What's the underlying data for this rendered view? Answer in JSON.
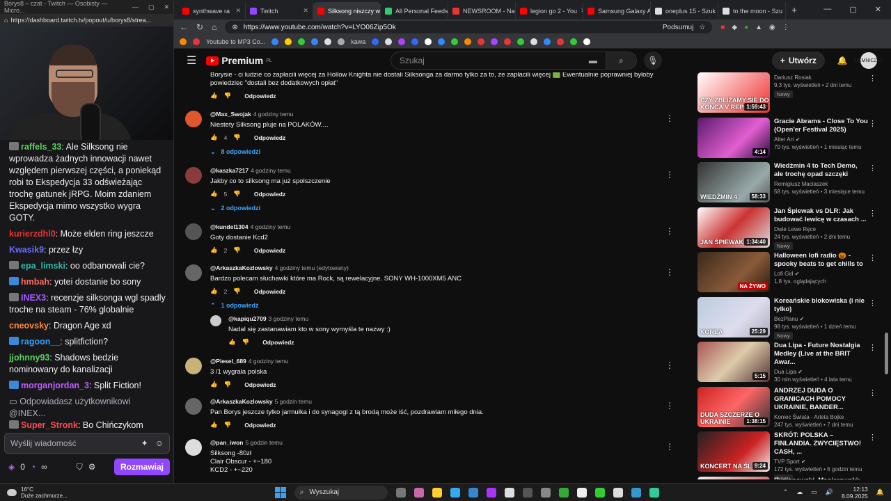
{
  "twitch": {
    "title": "Borys8 – czat - Twitch — Osobisty — Micro...",
    "url": "https://dashboard.twitch.tv/popout/u/borys8/strea...",
    "messages": [
      {
        "user": "raffels_33",
        "color": "#5fd05f",
        "badge": "g",
        "text": "Ale Silksong nie wprowadza żadnych innowacji nawet względem pierwszej części, a poniekąd robi to Ekspedycja 33 odświeżając trochę gatunek jRPG. Moim zdaniem Ekspedycja mimo wszystko wygra GOTY."
      },
      {
        "user": "kurierzdhl0",
        "color": "#e5332f",
        "badge": "",
        "text": "Może elden ring jeszcze"
      },
      {
        "user": "Kwasik9",
        "color": "#6b6bff",
        "badge": "",
        "text": "przez łzy"
      },
      {
        "user": "epa_limski",
        "color": "#2fb5a5",
        "badge": "g",
        "text": "oo odbanowali cie?"
      },
      {
        "user": "hmbah",
        "color": "#ff6a5b",
        "badge": "b",
        "text": "yotei dostanie bo sony"
      },
      {
        "user": "INEX3",
        "color": "#a45bff",
        "badge": "g",
        "text": "recenzje silksonga wgl spadly troche na steam - 76% globalnie"
      },
      {
        "user": "cneovsky",
        "color": "#ff8a3a",
        "badge": "",
        "text": "Dragon Age xd"
      },
      {
        "user": "ragoon__",
        "color": "#2fa0ff",
        "badge": "b",
        "text": "splitfiction?"
      },
      {
        "user": "jjohnny93",
        "color": "#5fd05f",
        "badge": "",
        "text": "Shadows bedzie nominowany do kanalizacji"
      },
      {
        "user": "morganjordan_3",
        "color": "#c45bff",
        "badge": "b",
        "text": "Split Fiction!"
      }
    ],
    "reply_note": "Odpowiadasz użytkownikowi @INEX...",
    "last_msg": {
      "user": "Super_Stronk",
      "color": "#ff4a4a",
      "text": "Bo Chińczykom tłumaczenie się nie podoba"
    },
    "input_placeholder": "Wyślij wiadomość",
    "points": "0",
    "infinity": "∞",
    "chat_button": "Rozmawiaj"
  },
  "browser": {
    "tabs": [
      {
        "label": "synthwave ra",
        "color": "#f00"
      },
      {
        "label": "Twitch",
        "color": "#9147ff"
      },
      {
        "label": "Silksong niszczy w",
        "color": "#f00",
        "active": true
      },
      {
        "label": "All Personal Feeds",
        "color": "#2ecc71"
      },
      {
        "label": "NEWSROOM - Na",
        "color": "#e33"
      },
      {
        "label": "legion go 2 - You",
        "color": "#f00"
      },
      {
        "label": "Samsung Galaxy A",
        "color": "#f00"
      },
      {
        "label": "oneplus 15 - Szuk",
        "color": "#ddd"
      },
      {
        "label": "to the moon - Szu",
        "color": "#ddd"
      }
    ],
    "url": "https://www.youtube.com/watch?v=LYO06Zip5Ok",
    "summarize": "Podsumuj",
    "bookmarks": [
      "Youtube to MP3 Co...",
      "kawa"
    ]
  },
  "youtube": {
    "logo": "Premium",
    "logo_sup": "PL",
    "search_placeholder": "Szukaj",
    "create": "Utwórz",
    "avatar_text": "ZIEMNICZAK",
    "reply_label": "Odpowiedz",
    "top_comment": {
      "text": "Borysie - ci ludzie co zapłacili więcej za Hollow Knighta nie dostali Silksonga za darmo tylko za to, że zapłacili więcej 🟩 Ewentualnie poprawniej byłoby powiedziec \"dostali bez  dodatkowych opłat\""
    },
    "comments": [
      {
        "user": "@Max_Swojak",
        "time": "4 godziny temu",
        "text": "Niestety Silksong pluje na POLAKÓW....",
        "likes": "4",
        "replies": "8 odpowiedzi",
        "av": "#e0562d"
      },
      {
        "user": "@kaszka7217",
        "time": "4 godziny temu",
        "text": "Jakby co to silksong ma już spolszczenie",
        "likes": "5",
        "replies": "2 odpowiedzi",
        "av": "#8a3b3b"
      },
      {
        "user": "@kundel1304",
        "time": "4 godziny temu",
        "text": "Goty dostanie Kcd2",
        "likes": "2",
        "replies": "",
        "av": "#555"
      },
      {
        "user": "@ArkaszkaKozlowsky",
        "time": "4 godziny temu (edytowany)",
        "text": "Bardzo polecam słuchawki które ma Rock, są rewelacyjne. SONY WH-1000XM5 ANC",
        "likes": "2",
        "replies": "1 odpowiedź",
        "av": "#666"
      },
      {
        "user": "@Piesel_689",
        "time": "4 godziny temu",
        "text": "3 /1  wygrała polska",
        "likes": "",
        "replies": "",
        "av": "#c9b27a"
      },
      {
        "user": "@ArkaszkaKozlowsky",
        "time": "5 godzin temu",
        "text": "Pan Borys jeszcze tylko jarmułka i do synagogi z tą brodą może iść, pozdrawiam miłego dnia.",
        "likes": "",
        "replies": "",
        "av": "#666"
      },
      {
        "user": "@pan_iwon",
        "time": "5 godzin temu",
        "text": "Silksong -80zł",
        "likes": "",
        "replies": "",
        "av": "#ddd"
      }
    ],
    "sub_reply": {
      "user": "@kapiqu2709",
      "time": "3 godziny temu",
      "text": "Nadal się zastanawiam kto w sony wymyśla te nazwy :)",
      "av": "#ccc"
    },
    "pan_iwon_lines": [
      "Clair Obscur - +~180",
      "KCD2 - +~220"
    ],
    "sidebar": [
      {
        "title": "",
        "channel": "Dariusz Rosiak",
        "stats": "9,3 tys. wyświetleń • 2 dni temu",
        "badge": "Nowy",
        "dur": "1:59:43",
        "bg": "linear-gradient(135deg,#fff,#e33)",
        "thumb_text": "CZY ZBLIŻAMY SIĘ DO KOŃCA V REPUBLIKI?",
        "verified": false
      },
      {
        "title": "Gracie Abrams - Close To You (Open'er Festival 2025)",
        "channel": "Alter Art",
        "stats": "70 tys. wyświetleń • 1 miesiąc temu",
        "badge": "",
        "dur": "4:14",
        "bg": "linear-gradient(135deg,#5a1a6a,#e25fd2 60%,#2a0a3a)",
        "thumb_text": "",
        "verified": true
      },
      {
        "title": "Wiedźmin 4 to Tech Demo, ale trochę opad szczęki",
        "channel": "Remigiusz Maciaszek",
        "stats": "58 tys. wyświetleń • 3 miesiące temu",
        "badge": "",
        "dur": "58:33",
        "bg": "linear-gradient(135deg,#333,#9aa 70%,#555)",
        "thumb_text": "WIEDŹMIN 4",
        "verified": false
      },
      {
        "title": "Jan Śpiewak vs DLR: Jak budować lewicę w czasach ...",
        "channel": "Dwie Lewe Ręce",
        "stats": "24 tys. wyświetleń • 2 dni temu",
        "badge": "Nowy",
        "dur": "1:34:40",
        "bg": "linear-gradient(135deg,#fff,#c33 50%,#ddd)",
        "thumb_text": "JAN ŚPIEWAK",
        "verified": false
      },
      {
        "title": "Halloween lofi radio 🎃 - spooky beats to get chills to",
        "channel": "Lofi Girl",
        "stats": "1,8 tys. oglądających",
        "badge": "",
        "dur": "NA ŻYWO",
        "bg": "linear-gradient(135deg,#3a2a1a,#8a5a3a 60%,#2a1a10)",
        "thumb_text": "",
        "verified": true
      },
      {
        "title": "Koreańskie blokowiska (i nie tylko)",
        "channel": "BezPlanu",
        "stats": "98 tys. wyświetleń • 1 dzień temu",
        "badge": "Nowy",
        "dur": "25:29",
        "bg": "linear-gradient(135deg,#bcd,#dde 60%,#aab)",
        "thumb_text": "KOREA",
        "verified": true
      },
      {
        "title": "Dua Lipa - Future Nostalgia Medley (Live at the BRIT Awar...",
        "channel": "Dua Lipa",
        "stats": "30 mln wyświetleń • 4 lata temu",
        "badge": "",
        "dur": "5:15",
        "bg": "linear-gradient(135deg,#a55,#dca 50%,#533)",
        "thumb_text": "",
        "verified": true
      },
      {
        "title": "ANDRZEJ DUDA O GRANICACH POMOCY UKRAINIE, BANDER...",
        "channel": "Koniec Świata - Arleta Bojke",
        "stats": "247 tys. wyświetleń • 7 dni temu",
        "badge": "",
        "dur": "1:38:15",
        "bg": "linear-gradient(135deg,#c22,#f66 50%,#333)",
        "thumb_text": "DUDA SZCZERZE O UKRAINIE",
        "verified": false
      },
      {
        "title": "SKRÓT: POLSKA – FINLANDIA. ZWYCIĘSTWO! CASH, ...",
        "channel": "TVP Sport",
        "stats": "172 tys. wyświetleń • 6 godzin temu",
        "badge": "Nowy",
        "dur": "9:24",
        "bg": "linear-gradient(135deg,#222,#c22 60%,#eee)",
        "thumb_text": "KONCERT NA ŚLĄSKU",
        "verified": true
      },
      {
        "title": "Rymanowski, Magierowski: Jak Karol z Donaldem",
        "channel": "",
        "stats": "",
        "badge": "",
        "dur": "",
        "bg": "linear-gradient(135deg,#eee,#c33)",
        "thumb_text": "",
        "verified": false
      }
    ]
  },
  "taskbar": {
    "temp": "16°C",
    "weather": "Duże zachmurze...",
    "search": "Wyszukaj",
    "time": "12:13",
    "date": "8.09.2025"
  }
}
